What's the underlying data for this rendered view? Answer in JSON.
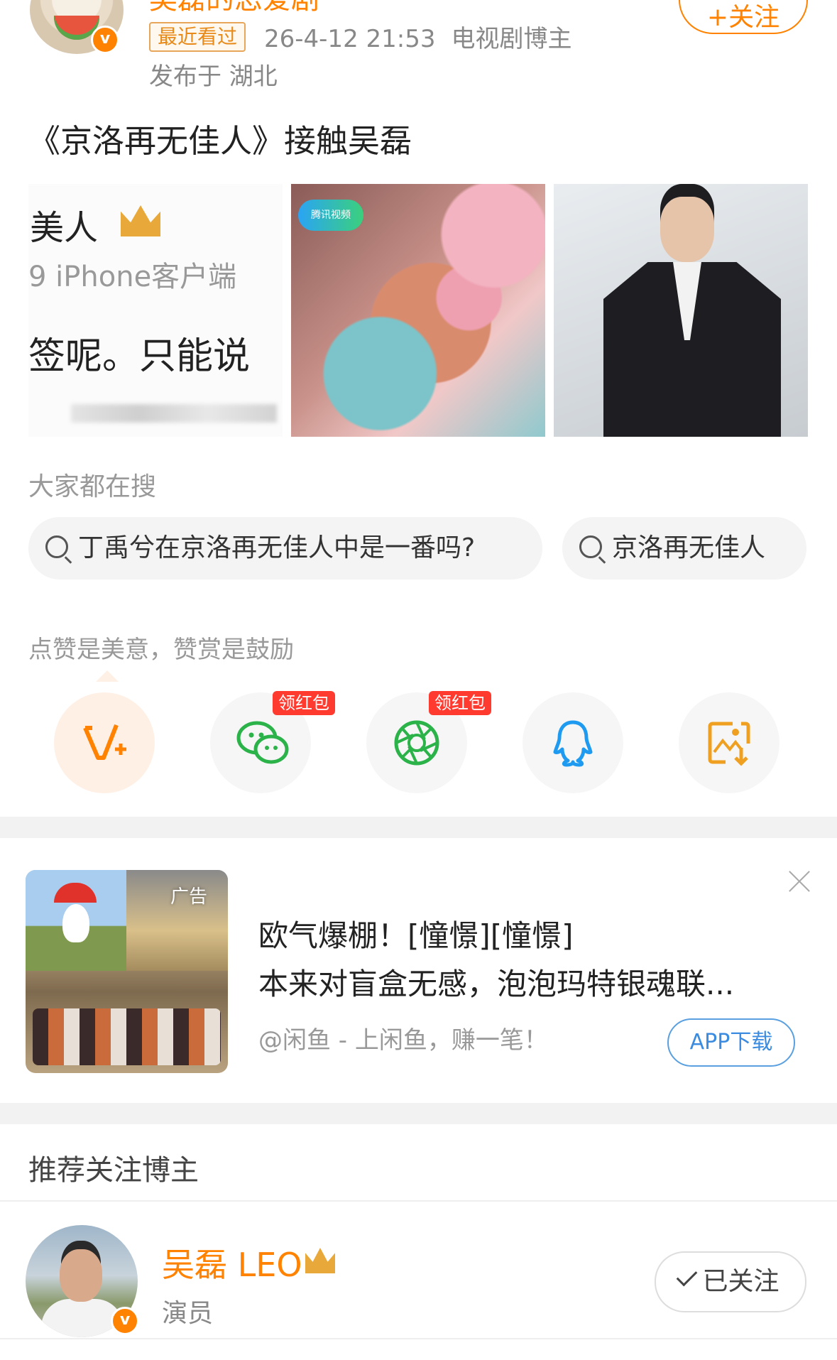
{
  "post": {
    "author_name_partial": "吴磊的恋爱剧",
    "recent_badge": "最近看过",
    "timestamp": "26-4-12 21:53",
    "author_role": "电视剧博主",
    "location": "发布于 湖北",
    "follow_label": "+关注",
    "text": "《京洛再无佳人》接触吴磊",
    "images": [
      {
        "line1": "美人",
        "line2": "9  iPhone客户端",
        "line3": "签呢。只能说"
      },
      {
        "watermark": "腾讯视频"
      },
      {}
    ]
  },
  "search": {
    "label": "大家都在搜",
    "chips": [
      "丁禹兮在京洛再无佳人中是一番吗?",
      "京洛再无佳人"
    ]
  },
  "share": {
    "label": "点赞是美意，赞赏是鼓励",
    "red_tag": "领红包",
    "buttons": [
      {
        "icon": "v-plus-icon",
        "color": "#ff8200"
      },
      {
        "icon": "wechat-icon",
        "color": "#2bb34a"
      },
      {
        "icon": "moments-icon",
        "color": "#2bb34a"
      },
      {
        "icon": "qq-icon",
        "color": "#1e9bf0"
      },
      {
        "icon": "save-image-icon",
        "color": "#f0a020"
      }
    ]
  },
  "ad": {
    "tag": "广告",
    "title_line1": "欧气爆棚！[憧憬][憧憬]",
    "title_line2": "本来对盲盒无感，泡泡玛特银魂联...",
    "source": "@闲鱼 - 上闲鱼，赚一笔！",
    "button": "APP下载"
  },
  "recommend": {
    "title": "推荐关注博主",
    "user": {
      "name": "吴磊 LEO",
      "role": "演员",
      "follow_state": "已关注"
    }
  },
  "colors": {
    "brand_orange": "#ff8200",
    "link_blue": "#3b8ce0",
    "red_packet": "#ff3b30"
  }
}
